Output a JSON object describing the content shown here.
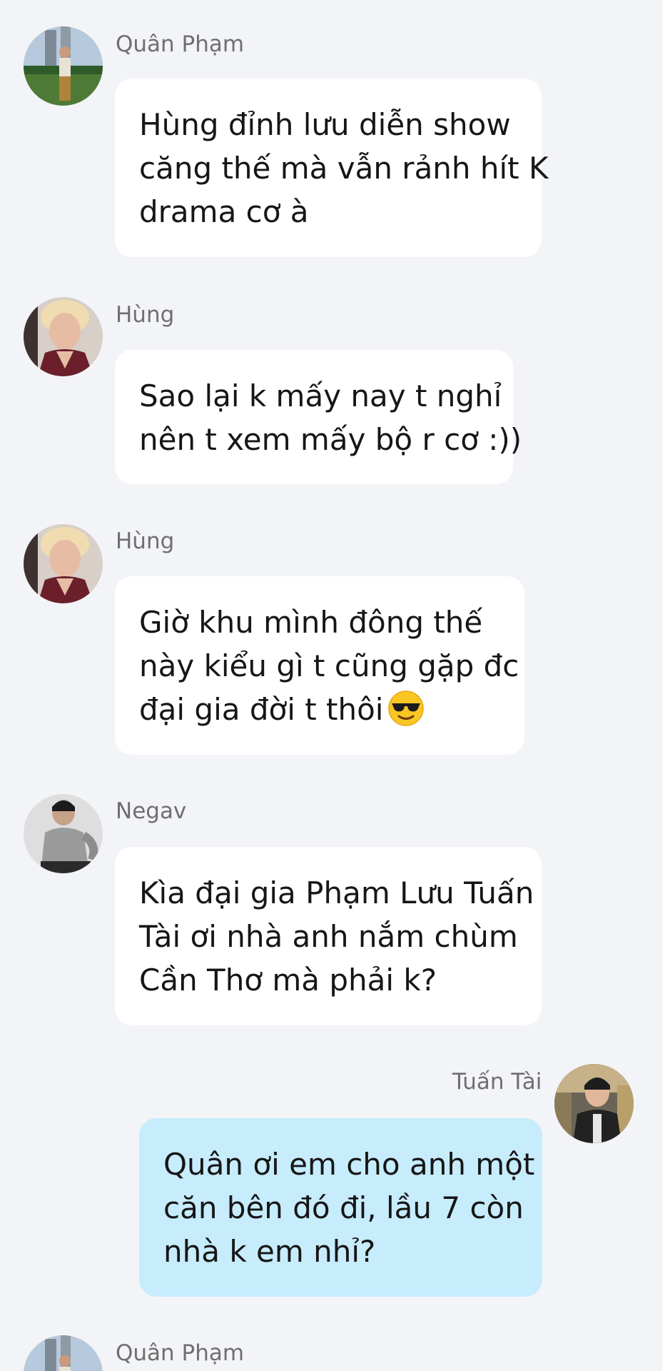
{
  "messages": [
    {
      "sender": "Quân Phạm",
      "direction": "incoming",
      "avatar": "avatar-quan-pham",
      "lines": [
        "Hùng đỉnh lưu diễn show",
        "căng thế mà vẫn rảnh hít K",
        "drama cơ à"
      ]
    },
    {
      "sender": "Hùng",
      "direction": "incoming",
      "avatar": "avatar-hung",
      "lines": [
        "Sao lại k mấy nay t nghỉ",
        "nên t xem mấy bộ r cơ :))"
      ]
    },
    {
      "sender": "Hùng",
      "direction": "incoming",
      "avatar": "avatar-hung",
      "lines": [
        "Giờ khu mình đông thế",
        "này kiểu gì t cũng gặp đc",
        "đại gia đời t thôi"
      ],
      "emoji": "sunglasses-emoji"
    },
    {
      "sender": "Negav",
      "direction": "incoming",
      "avatar": "avatar-negav",
      "lines": [
        "Kìa đại gia Phạm Lưu Tuấn",
        "Tài ơi nhà anh nắm chùm",
        "Cần Thơ mà phải k?"
      ]
    },
    {
      "sender": "Tuấn Tài",
      "direction": "outgoing",
      "avatar": "avatar-tuan-tai",
      "lines": [
        "Quân ơi em cho anh một",
        "căn bên đó đi, lầu 7 còn",
        "nhà k em nhỉ?"
      ]
    },
    {
      "sender": "Quân Phạm",
      "direction": "incoming",
      "avatar": "avatar-quan-pham",
      "lines": []
    }
  ],
  "colors": {
    "background": "#f3f4f7",
    "incoming_bubble": "#ffffff",
    "outgoing_bubble": "#c7ecfc",
    "sender_name": "#6f6f6f",
    "message_text": "#161616"
  }
}
